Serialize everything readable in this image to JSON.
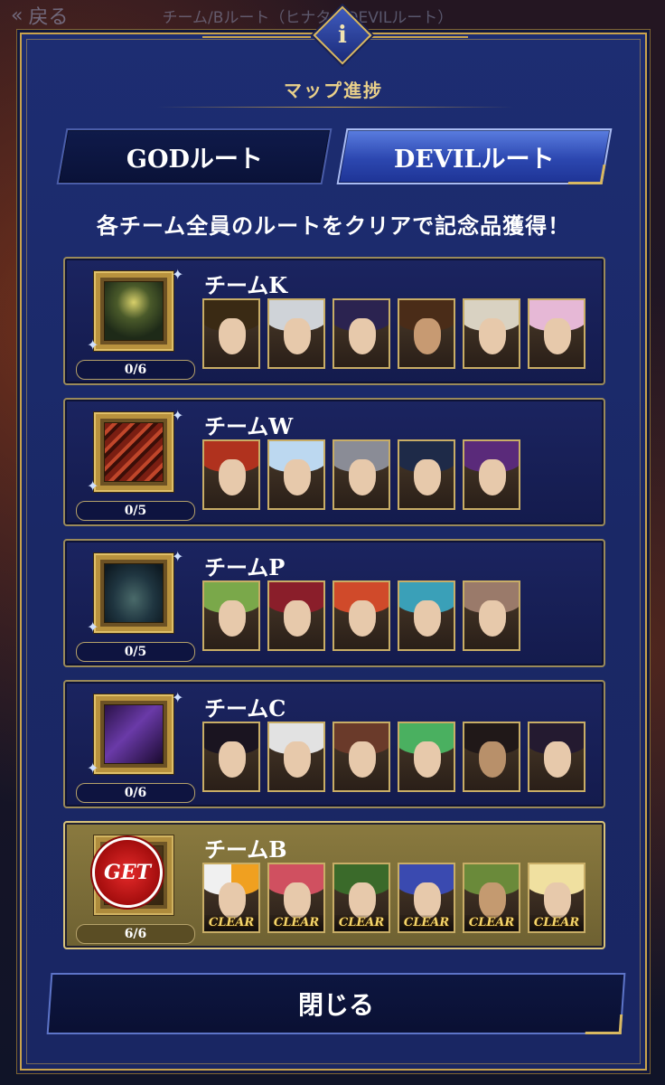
{
  "topbar": {
    "back_label": "戻る",
    "title": "チーム/Bルート（ヒナタ・DEVILルート）"
  },
  "modal": {
    "info_icon": "i",
    "title": "マップ進捗",
    "tabs": [
      {
        "label": "GODルート",
        "active": false
      },
      {
        "label": "DEVILルート",
        "active": true
      }
    ],
    "subtitle": "各チーム全員のルートをクリアで記念品獲得！",
    "teams": [
      {
        "name": "チームK",
        "progress": "0/6",
        "cleared": false,
        "member_count": 6
      },
      {
        "name": "チームW",
        "progress": "0/5",
        "cleared": false,
        "member_count": 5
      },
      {
        "name": "チームP",
        "progress": "0/5",
        "cleared": false,
        "member_count": 5
      },
      {
        "name": "チームC",
        "progress": "0/6",
        "cleared": false,
        "member_count": 6
      },
      {
        "name": "チームB",
        "progress": "6/6",
        "cleared": true,
        "member_count": 6,
        "get_label": "GET",
        "clear_label": "CLEAR"
      }
    ],
    "close_label": "閉じる"
  },
  "colors": {
    "gold": "#c9a34c",
    "panel_blue": "#1d2d72",
    "cleared_panel": "#8a7a3f",
    "get_red": "#e52a2a"
  }
}
